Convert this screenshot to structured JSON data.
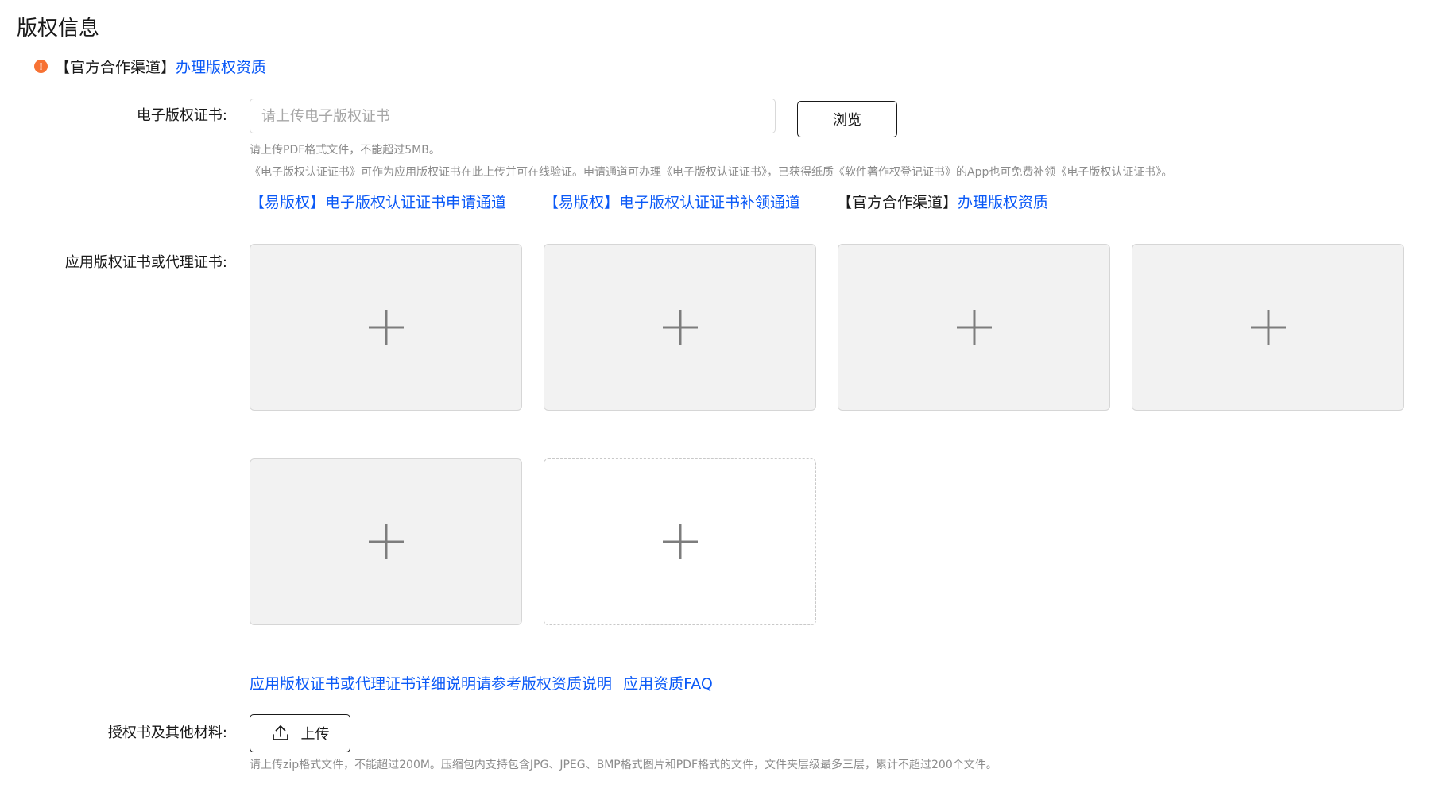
{
  "section": {
    "title": "版权信息"
  },
  "notice": {
    "channel_label": "【官方合作渠道】",
    "channel_link": "办理版权资质"
  },
  "ecert": {
    "label": "电子版权证书:",
    "placeholder": "请上传电子版权证书",
    "value": "",
    "browse_label": "浏览",
    "hint_format": "请上传PDF格式文件，不能超过5MB。",
    "hint_desc": "《电子版权认证证书》可作为应用版权证书在此上传并可在线验证。申请通道可办理《电子版权认证证书》，已获得纸质《软件著作权登记证书》的App也可免费补领《电子版权认证证书》。",
    "link_apply": "【易版权】电子版权认证证书申请通道",
    "link_reissue": "【易版权】电子版权认证证书补领通道",
    "official_label": "【官方合作渠道】",
    "official_link": "办理版权资质"
  },
  "app_cert": {
    "label": "应用版权证书或代理证书:",
    "uploaded_count": 5,
    "link_detail": "应用版权证书或代理证书详细说明请参考版权资质说明",
    "link_faq": "应用资质FAQ"
  },
  "auth": {
    "label": "授权书及其他材料:",
    "upload_label": "上传",
    "hint": "请上传zip格式文件，不能超过200M。压缩包内支持包含JPG、JPEG、BMP格式图片和PDF格式的文件，文件夹层级最多三层，累计不超过200个文件。"
  },
  "icons": {
    "warning": "exclamation-circle-icon",
    "plus": "plus-icon",
    "upload": "upload-arrow-icon"
  },
  "colors": {
    "link": "#0a59f7",
    "warning": "#f77234",
    "tile_bg": "#f2f2f2",
    "text": "#191919",
    "hint": "#8c8c8c"
  }
}
